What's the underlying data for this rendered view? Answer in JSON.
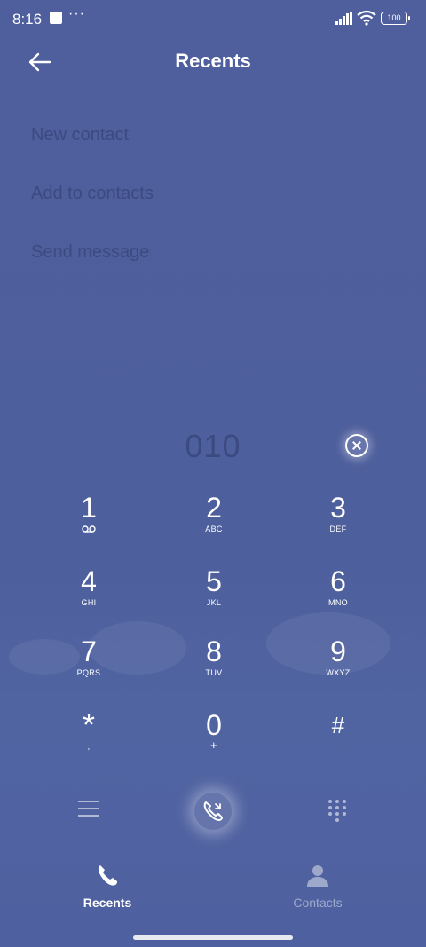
{
  "status_bar": {
    "time": "8:16",
    "battery": "100",
    "icons": [
      "notification-square-icon",
      "more-dots-icon",
      "signal-icon",
      "wifi-icon",
      "battery-icon"
    ]
  },
  "header": {
    "title": "Recents",
    "back_icon": "back-arrow-icon"
  },
  "options": [
    {
      "label": "New contact"
    },
    {
      "label": "Add to contacts"
    },
    {
      "label": "Send message"
    }
  ],
  "dialer": {
    "number": "010",
    "clear_icon": "clear-circle-icon"
  },
  "keypad": [
    {
      "digit": "1",
      "letters": ""
    },
    {
      "digit": "2",
      "letters": "ABC"
    },
    {
      "digit": "3",
      "letters": "DEF"
    },
    {
      "digit": "4",
      "letters": "GHI"
    },
    {
      "digit": "5",
      "letters": "JKL"
    },
    {
      "digit": "6",
      "letters": "MNO"
    },
    {
      "digit": "7",
      "letters": "PQRS"
    },
    {
      "digit": "8",
      "letters": "TUV"
    },
    {
      "digit": "9",
      "letters": "WXYZ"
    },
    {
      "digit": "*",
      "letters": ","
    },
    {
      "digit": "0",
      "letters": "+"
    },
    {
      "digit": "#",
      "letters": ""
    }
  ],
  "actions": {
    "menu_icon": "hamburger-menu-icon",
    "call_icon": "phone-call-icon",
    "dialpad_icon": "dialpad-icon"
  },
  "bottom_nav": [
    {
      "label": "Recents",
      "icon": "phone-icon",
      "active": true
    },
    {
      "label": "Contacts",
      "icon": "person-icon",
      "active": false
    }
  ],
  "colors": {
    "background": "#4d5f9c",
    "option_text": "#3b4a80",
    "text": "#ffffff"
  }
}
